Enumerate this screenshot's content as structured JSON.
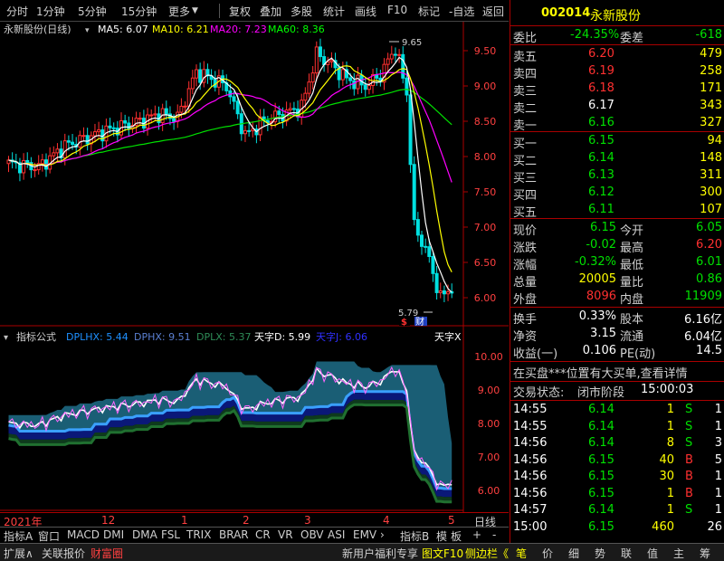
{
  "toolbar": {
    "period_buttons": [
      "分时",
      "1分钟",
      "5分钟",
      "15分钟",
      "更多"
    ],
    "action_buttons": [
      "复权",
      "叠加",
      "多股",
      "统计",
      "画线",
      "F10",
      "标记",
      "-自选",
      "返回"
    ]
  },
  "main_chart": {
    "stock_label": "永新股份(日线)",
    "ma": [
      {
        "label": "MA5: 6.07",
        "color": "#ffffff"
      },
      {
        "label": "MA10: 6.21",
        "color": "#ffff00"
      },
      {
        "label": "MA20: 7.23",
        "color": "#ff00ff"
      },
      {
        "label": "MA60: 8.36",
        "color": "#00ff00"
      }
    ],
    "y_ticks": [
      "9.50",
      "9.00",
      "8.50",
      "8.00",
      "7.50",
      "7.00",
      "6.50",
      "6.00"
    ],
    "high_marker": "9.65",
    "low_marker": "5.79",
    "icon_s": "$",
    "icon_cai": "财"
  },
  "indicator": {
    "title": "指标公式",
    "series": [
      {
        "label": "DPLHX: 5.44",
        "color": "#1e90ff"
      },
      {
        "label": "DPHX: 9.51",
        "color": "#5a7fd0"
      },
      {
        "label": "DPLX: 5.37",
        "color": "#2e8b57"
      },
      {
        "label": "天字D: 5.99",
        "color": "#ffffff"
      },
      {
        "label": "天字J: 6.06",
        "color": "#3030ff"
      }
    ],
    "close_label": "天字X",
    "y_ticks": [
      "10.00",
      "9.00",
      "8.00",
      "7.00",
      "6.00"
    ]
  },
  "x_axis": {
    "labels": [
      "2021年",
      "12",
      "1",
      "2",
      "3",
      "4",
      "5"
    ],
    "period": "日线"
  },
  "bottom_tabs": [
    "指标A",
    "窗口",
    "MACD",
    "DMI",
    "DMA",
    "FSL",
    "TRIX",
    "BRAR",
    "CR",
    "VR",
    "OBV",
    "ASI",
    "EMV",
    "指标B",
    "模",
    "板",
    "+",
    "-"
  ],
  "quote": {
    "code": "002014",
    "name": "永新股份",
    "weibi_label": "委比",
    "weibi": "-24.35%",
    "weicha_label": "委差",
    "weicha": "-618",
    "asks": [
      {
        "label": "卖五",
        "price": "6.20",
        "vol": "479"
      },
      {
        "label": "卖四",
        "price": "6.19",
        "vol": "258"
      },
      {
        "label": "卖三",
        "price": "6.18",
        "vol": "171"
      },
      {
        "label": "卖二",
        "price": "6.17",
        "vol": "343"
      },
      {
        "label": "卖一",
        "price": "6.16",
        "vol": "327"
      }
    ],
    "bids": [
      {
        "label": "买一",
        "price": "6.15",
        "vol": "94"
      },
      {
        "label": "买二",
        "price": "6.14",
        "vol": "148"
      },
      {
        "label": "买三",
        "price": "6.13",
        "vol": "311"
      },
      {
        "label": "买四",
        "price": "6.12",
        "vol": "300"
      },
      {
        "label": "买五",
        "price": "6.11",
        "vol": "107"
      }
    ],
    "stats": [
      {
        "l1": "现价",
        "v1": "6.15",
        "l2": "今开",
        "v2": "6.05"
      },
      {
        "l1": "涨跌",
        "v1": "-0.02",
        "l2": "最高",
        "v2": "6.20"
      },
      {
        "l1": "涨幅",
        "v1": "-0.32%",
        "l2": "最低",
        "v2": "6.01"
      },
      {
        "l1": "总量",
        "v1": "20005",
        "l2": "量比",
        "v2": "0.86"
      },
      {
        "l1": "外盘",
        "v1": "8096",
        "l2": "内盘",
        "v2": "11909"
      }
    ],
    "fin": [
      {
        "l1": "换手",
        "v1": "0.33%",
        "l2": "股本",
        "v2": "6.16亿"
      },
      {
        "l1": "净资",
        "v1": "3.15",
        "l2": "流通",
        "v2": "6.04亿"
      },
      {
        "l1": "收益(一)",
        "v1": "0.106",
        "l2": "PE(动)",
        "v2": "14.5"
      }
    ],
    "notice": "在买盘***位置有大买单,查看详情",
    "state_label": "交易状态:",
    "state_value": "闭市阶段",
    "state_time": "15:00:03"
  },
  "ticks": [
    {
      "time": "14:55",
      "price": "6.14",
      "vol": "1",
      "side": "S",
      "n": "1"
    },
    {
      "time": "14:55",
      "price": "6.14",
      "vol": "1",
      "side": "S",
      "n": "1"
    },
    {
      "time": "14:56",
      "price": "6.14",
      "vol": "8",
      "side": "S",
      "n": "3"
    },
    {
      "time": "14:56",
      "price": "6.15",
      "vol": "40",
      "side": "B",
      "n": "5"
    },
    {
      "time": "14:56",
      "price": "6.15",
      "vol": "30",
      "side": "B",
      "n": "1"
    },
    {
      "time": "14:56",
      "price": "6.15",
      "vol": "1",
      "side": "B",
      "n": "1"
    },
    {
      "time": "14:57",
      "price": "6.14",
      "vol": "1",
      "side": "S",
      "n": "1"
    },
    {
      "time": "15:00",
      "price": "6.15",
      "vol": "460",
      "side": "",
      "n": "26"
    }
  ],
  "status_bar": {
    "left": [
      "扩展∧",
      "关联报价",
      "财富圈"
    ],
    "middle": [
      "新用户福利专享",
      "图文F10",
      "侧边栏《"
    ],
    "right": [
      "笔",
      "价",
      "细",
      "势",
      "联",
      "值",
      "主",
      "筹"
    ]
  },
  "colors": {
    "up": "#ff3030",
    "down": "#00e000",
    "accent_border": "#aa0000",
    "text": "#d0d0d0"
  }
}
